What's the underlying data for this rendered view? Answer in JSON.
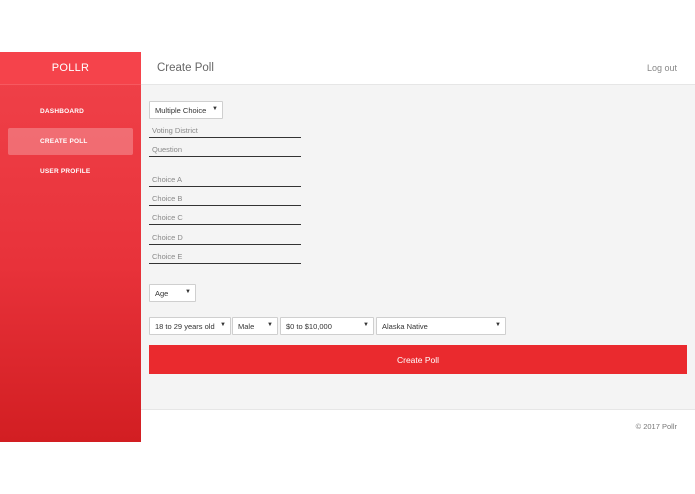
{
  "sidebar": {
    "brand": "POLLR",
    "items": [
      {
        "label": "DASHBOARD"
      },
      {
        "label": "CREATE POLL"
      },
      {
        "label": "USER PROFILE"
      }
    ]
  },
  "header": {
    "title": "Create Poll",
    "logout": "Log out"
  },
  "form": {
    "poll_type": "Multiple Choice",
    "voting_district_placeholder": "Voting District",
    "question_placeholder": "Question",
    "choices": [
      {
        "placeholder": "Choice A"
      },
      {
        "placeholder": "Choice B"
      },
      {
        "placeholder": "Choice C"
      },
      {
        "placeholder": "Choice D"
      },
      {
        "placeholder": "Choice E"
      }
    ],
    "demographic": "Age",
    "filters": {
      "age_range": "18 to 29 years old",
      "gender": "Male",
      "income": "$0 to $10,000",
      "ethnicity": "Alaska Native"
    },
    "submit_label": "Create Poll"
  },
  "footer": {
    "copyright": "© 2017 Pollr"
  },
  "colors": {
    "accent": "#ea2a2e",
    "sidebar_top": "#f0424a",
    "sidebar_bottom": "#d21e22",
    "content_bg": "#f4f4f4"
  }
}
